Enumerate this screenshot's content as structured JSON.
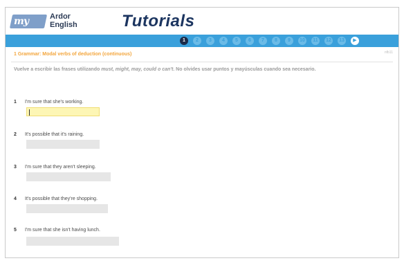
{
  "header": {
    "logo_mark": "my",
    "logo_line1": "Ardor",
    "logo_line2": "English",
    "title": "Tutorials"
  },
  "nav": {
    "steps": [
      "1",
      "2",
      "3",
      "4",
      "5",
      "6",
      "7",
      "8",
      "9",
      "10",
      "11",
      "12",
      "13"
    ],
    "active_index": 0,
    "next_label": "▶"
  },
  "section": {
    "title": "1 Grammar: Modal verbs of deduction (continuous)",
    "corner": "nfb11"
  },
  "instructions": {
    "lead": "Vuelve a escribir las frases utilizando ",
    "words": "must, might, may, could o can't",
    "tail": ". No olvides usar puntos y mayúsculas cuando sea necesario."
  },
  "questions": [
    {
      "num": "1",
      "text": "I'm sure that she's working.",
      "answer": ""
    },
    {
      "num": "2",
      "text": "It's possible that it's raining.",
      "answer": ""
    },
    {
      "num": "3",
      "text": "I'm sure that they aren't sleeping.",
      "answer": ""
    },
    {
      "num": "4",
      "text": "It's possible that they're shopping.",
      "answer": ""
    },
    {
      "num": "5",
      "text": "I'm sure that she isn't having lunch.",
      "answer": ""
    }
  ],
  "colors": {
    "nav_bar": "#3aa0db",
    "title": "#1c3560",
    "section_title": "#f3a53b",
    "active_input": "#fdf6b5"
  }
}
